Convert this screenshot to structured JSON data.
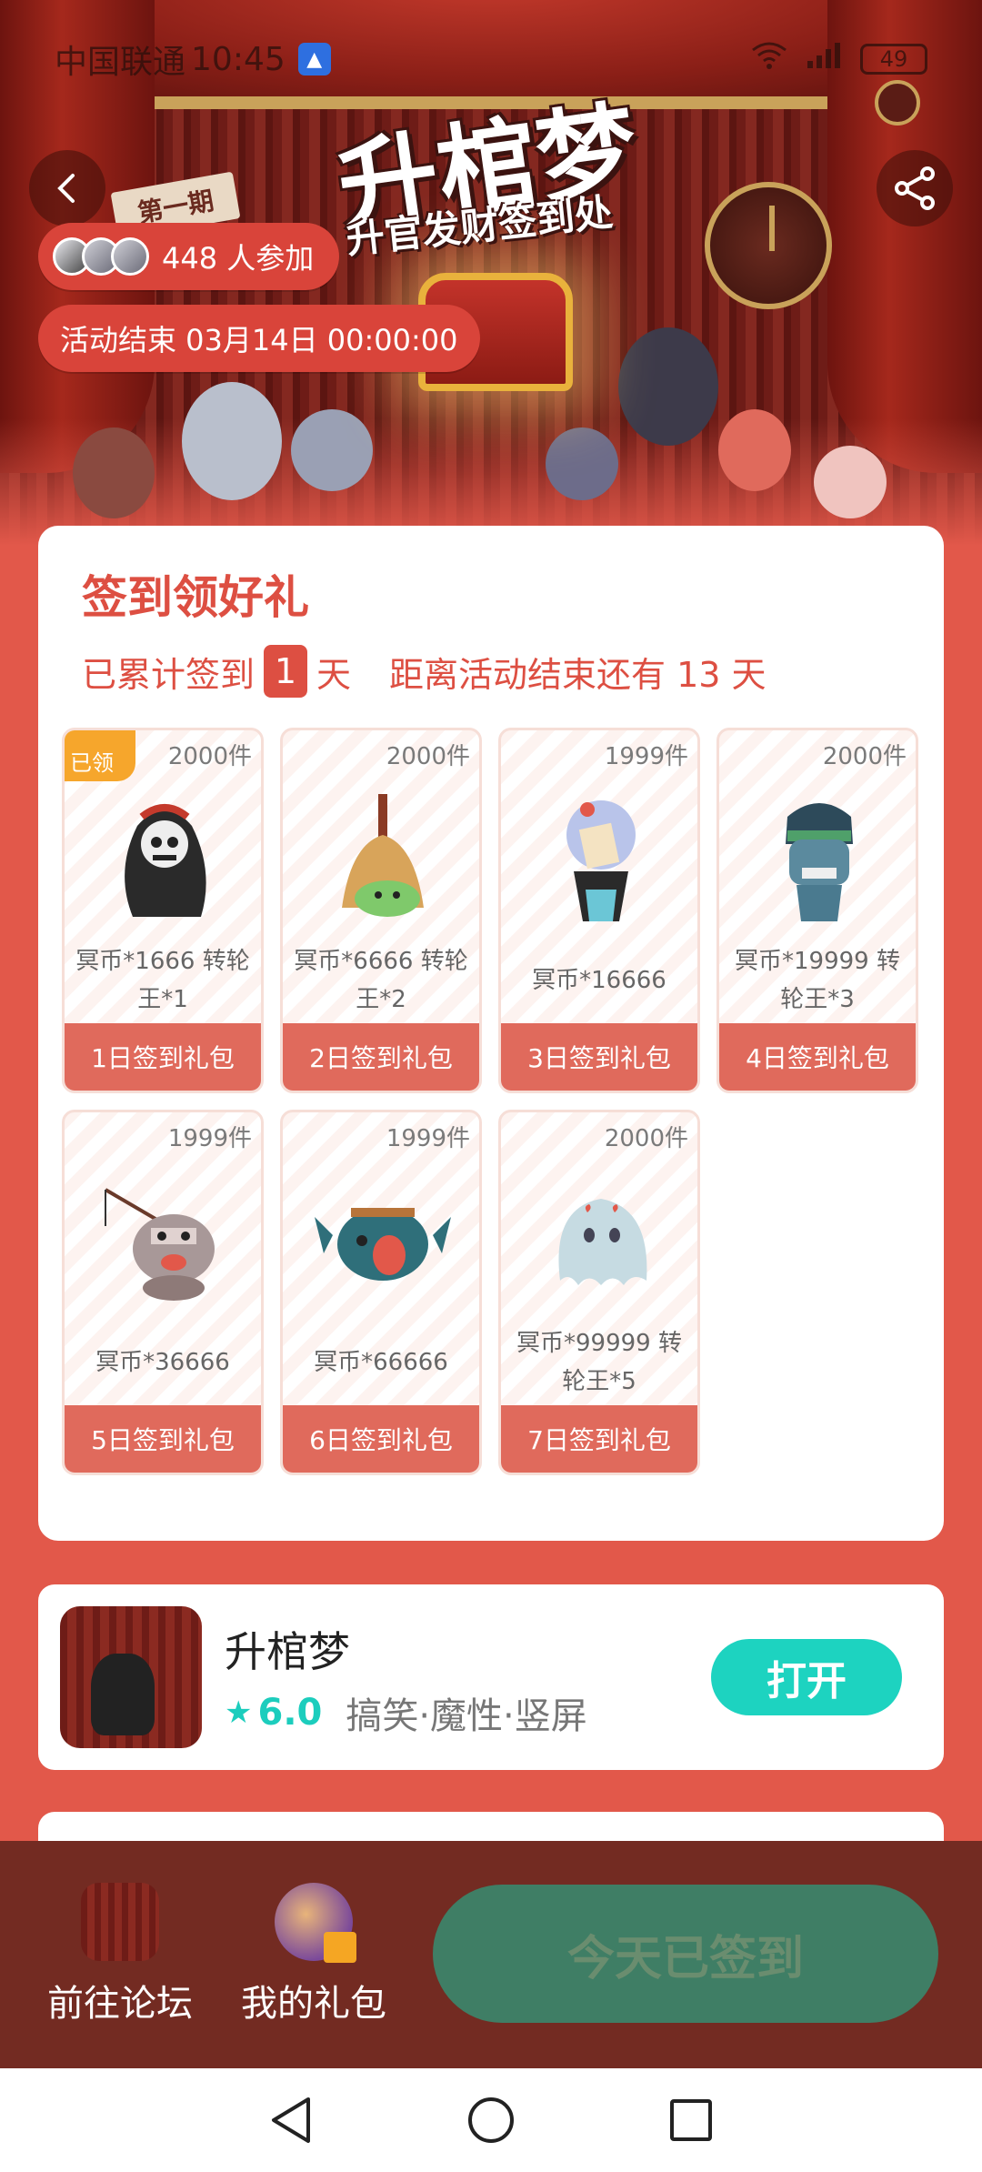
{
  "status_bar": {
    "carrier": "中国联通",
    "time": "10:45",
    "battery": "49"
  },
  "hero": {
    "title": "升棺梦",
    "subtitle": "升官发财签到处",
    "period_tag": "第一期",
    "participants": "448 人参加",
    "end_time": "活动结束 03月14日 00:00:00"
  },
  "signin": {
    "title": "签到领好礼",
    "accumulated_prefix": "已累计签到",
    "accumulated_days": "1",
    "day_unit": "天",
    "remaining_text": "距离活动结束还有 13 天"
  },
  "gifts": [
    {
      "stock": "2000件",
      "desc": "冥币*1666 转轮王*1",
      "label": "1日签到礼包",
      "claimed": "已领"
    },
    {
      "stock": "2000件",
      "desc": "冥币*6666 转轮王*2",
      "label": "2日签到礼包"
    },
    {
      "stock": "1999件",
      "desc": "冥币*16666",
      "label": "3日签到礼包"
    },
    {
      "stock": "2000件",
      "desc": "冥币*19999 转轮王*3",
      "label": "4日签到礼包"
    },
    {
      "stock": "1999件",
      "desc": "冥币*36666",
      "label": "5日签到礼包"
    },
    {
      "stock": "1999件",
      "desc": "冥币*66666",
      "label": "6日签到礼包"
    },
    {
      "stock": "2000件",
      "desc": "冥币*99999 转轮王*5",
      "label": "7日签到礼包"
    }
  ],
  "app": {
    "name": "升棺梦",
    "rating": "6.0",
    "tags": "搞笑·魔性·竖屏",
    "open_label": "打开"
  },
  "action_bar": {
    "forum_label": "前往论坛",
    "gifts_label": "我的礼包",
    "signed_label": "今天已签到"
  },
  "colors": {
    "accent": "#dd4f42",
    "teal": "#1dd3c0",
    "bar_bg": "#732b22",
    "signed_btn": "#3f7e65"
  }
}
